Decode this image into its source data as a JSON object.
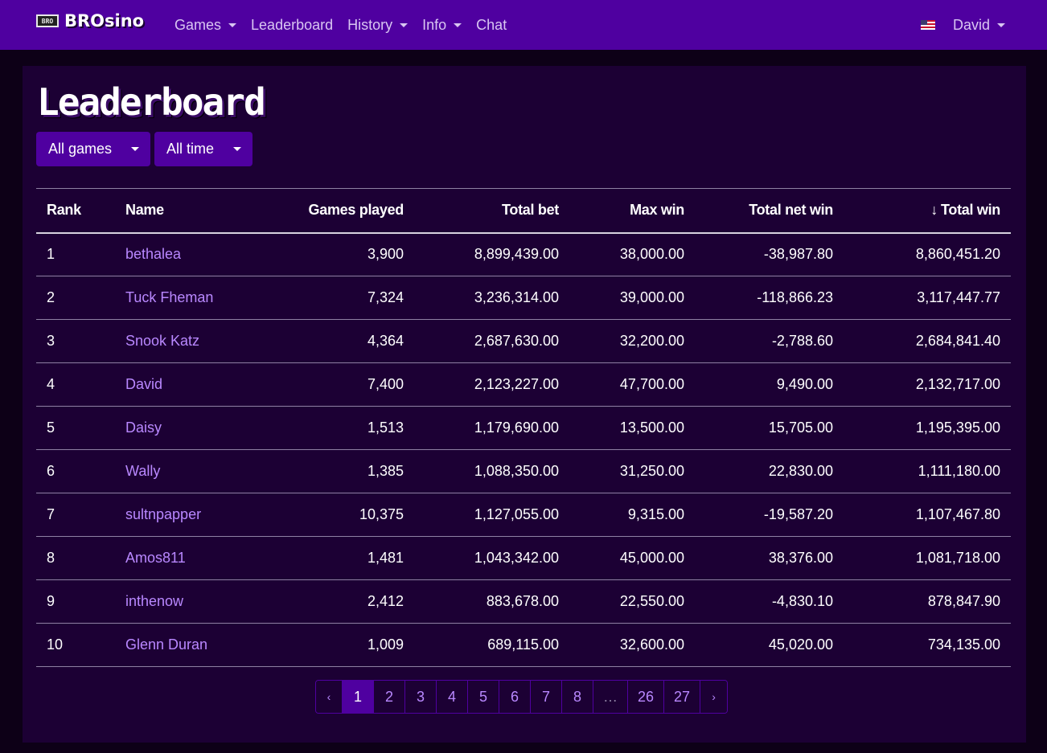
{
  "navbar": {
    "logo_badge": "BRO",
    "brand": "BROsino",
    "links": [
      {
        "label": "Games",
        "dropdown": true
      },
      {
        "label": "Leaderboard",
        "dropdown": false
      },
      {
        "label": "History",
        "dropdown": true
      },
      {
        "label": "Info",
        "dropdown": true
      },
      {
        "label": "Chat",
        "dropdown": false
      }
    ],
    "user": "David",
    "locale_icon": "us-flag-icon"
  },
  "page": {
    "title": "Leaderboard",
    "filters": {
      "game": "All games",
      "period": "All time"
    }
  },
  "table": {
    "headers": {
      "rank": "Rank",
      "name": "Name",
      "games_played": "Games played",
      "total_bet": "Total bet",
      "max_win": "Max win",
      "total_net_win": "Total net win",
      "total_win": "Total win"
    },
    "sort_icon": "arrow-down-icon",
    "rows": [
      {
        "rank": "1",
        "name": "bethalea",
        "games_played": "3,900",
        "total_bet": "8,899,439.00",
        "max_win": "38,000.00",
        "total_net_win": "-38,987.80",
        "total_win": "8,860,451.20"
      },
      {
        "rank": "2",
        "name": "Tuck Fheman",
        "games_played": "7,324",
        "total_bet": "3,236,314.00",
        "max_win": "39,000.00",
        "total_net_win": "-118,866.23",
        "total_win": "3,117,447.77"
      },
      {
        "rank": "3",
        "name": "Snook Katz",
        "games_played": "4,364",
        "total_bet": "2,687,630.00",
        "max_win": "32,200.00",
        "total_net_win": "-2,788.60",
        "total_win": "2,684,841.40"
      },
      {
        "rank": "4",
        "name": "David",
        "games_played": "7,400",
        "total_bet": "2,123,227.00",
        "max_win": "47,700.00",
        "total_net_win": "9,490.00",
        "total_win": "2,132,717.00"
      },
      {
        "rank": "5",
        "name": "Daisy",
        "games_played": "1,513",
        "total_bet": "1,179,690.00",
        "max_win": "13,500.00",
        "total_net_win": "15,705.00",
        "total_win": "1,195,395.00"
      },
      {
        "rank": "6",
        "name": "Wally",
        "games_played": "1,385",
        "total_bet": "1,088,350.00",
        "max_win": "31,250.00",
        "total_net_win": "22,830.00",
        "total_win": "1,111,180.00"
      },
      {
        "rank": "7",
        "name": "sultnpapper",
        "games_played": "10,375",
        "total_bet": "1,127,055.00",
        "max_win": "9,315.00",
        "total_net_win": "-19,587.20",
        "total_win": "1,107,467.80"
      },
      {
        "rank": "8",
        "name": "Amos811",
        "games_played": "1,481",
        "total_bet": "1,043,342.00",
        "max_win": "45,000.00",
        "total_net_win": "38,376.00",
        "total_win": "1,081,718.00"
      },
      {
        "rank": "9",
        "name": "inthenow",
        "games_played": "2,412",
        "total_bet": "883,678.00",
        "max_win": "22,550.00",
        "total_net_win": "-4,830.10",
        "total_win": "878,847.90"
      },
      {
        "rank": "10",
        "name": "Glenn Duran",
        "games_played": "1,009",
        "total_bet": "689,115.00",
        "max_win": "32,600.00",
        "total_net_win": "45,020.00",
        "total_win": "734,135.00"
      }
    ]
  },
  "pagination": {
    "prev": "‹",
    "next": "›",
    "pages": [
      "1",
      "2",
      "3",
      "4",
      "5",
      "6",
      "7",
      "8",
      "…",
      "26",
      "27"
    ],
    "active": "1"
  },
  "colors": {
    "navbar": "#4f00a0",
    "card": "#1c0034",
    "background": "#0d0017",
    "link": "#b988ff"
  }
}
